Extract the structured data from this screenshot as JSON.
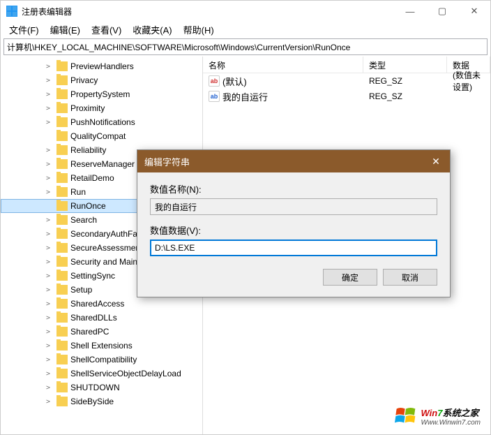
{
  "window": {
    "title": "注册表编辑器",
    "controls": {
      "min": "—",
      "max": "▢",
      "close": "✕"
    }
  },
  "menu": [
    {
      "label": "文件(F)"
    },
    {
      "label": "编辑(E)"
    },
    {
      "label": "查看(V)"
    },
    {
      "label": "收藏夹(A)"
    },
    {
      "label": "帮助(H)"
    }
  ],
  "address": "计算机\\HKEY_LOCAL_MACHINE\\SOFTWARE\\Microsoft\\Windows\\CurrentVersion\\RunOnce",
  "tree": [
    {
      "indent": 3,
      "expand": ">",
      "label": "PreviewHandlers"
    },
    {
      "indent": 3,
      "expand": ">",
      "label": "Privacy"
    },
    {
      "indent": 3,
      "expand": ">",
      "label": "PropertySystem"
    },
    {
      "indent": 3,
      "expand": ">",
      "label": "Proximity"
    },
    {
      "indent": 3,
      "expand": ">",
      "label": "PushNotifications"
    },
    {
      "indent": 3,
      "expand": "",
      "label": "QualityCompat"
    },
    {
      "indent": 3,
      "expand": ">",
      "label": "Reliability"
    },
    {
      "indent": 3,
      "expand": ">",
      "label": "ReserveManager"
    },
    {
      "indent": 3,
      "expand": ">",
      "label": "RetailDemo"
    },
    {
      "indent": 3,
      "expand": ">",
      "label": "Run"
    },
    {
      "indent": 3,
      "expand": "",
      "label": "RunOnce",
      "selected": true
    },
    {
      "indent": 3,
      "expand": ">",
      "label": "Search"
    },
    {
      "indent": 3,
      "expand": ">",
      "label": "SecondaryAuthFactor"
    },
    {
      "indent": 3,
      "expand": ">",
      "label": "SecureAssessment"
    },
    {
      "indent": 3,
      "expand": ">",
      "label": "Security and Maintenance"
    },
    {
      "indent": 3,
      "expand": ">",
      "label": "SettingSync"
    },
    {
      "indent": 3,
      "expand": ">",
      "label": "Setup"
    },
    {
      "indent": 3,
      "expand": ">",
      "label": "SharedAccess"
    },
    {
      "indent": 3,
      "expand": ">",
      "label": "SharedDLLs"
    },
    {
      "indent": 3,
      "expand": ">",
      "label": "SharedPC"
    },
    {
      "indent": 3,
      "expand": ">",
      "label": "Shell Extensions"
    },
    {
      "indent": 3,
      "expand": ">",
      "label": "ShellCompatibility"
    },
    {
      "indent": 3,
      "expand": ">",
      "label": "ShellServiceObjectDelayLoad"
    },
    {
      "indent": 3,
      "expand": ">",
      "label": "SHUTDOWN"
    },
    {
      "indent": 3,
      "expand": ">",
      "label": "SideBySide"
    }
  ],
  "list": {
    "columns": {
      "name": "名称",
      "type": "类型",
      "data": "数据"
    },
    "rows": [
      {
        "icon": "ab",
        "iconStyle": "red",
        "name": "(默认)",
        "type": "REG_SZ",
        "data": "(数值未设置)"
      },
      {
        "icon": "ab",
        "iconStyle": "blue",
        "name": "我的自运行",
        "type": "REG_SZ",
        "data": ""
      }
    ]
  },
  "dialog": {
    "title": "编辑字符串",
    "name_label": "数值名称(N):",
    "name_value": "我的自运行",
    "data_label": "数值数据(V):",
    "data_value": "D:\\LS.EXE",
    "ok": "确定",
    "cancel": "取消",
    "close": "✕"
  },
  "watermark": {
    "line1a": "Win",
    "line1b": "7",
    "line1c": "系统之家",
    "line2": "Www.Winwin7.com"
  }
}
